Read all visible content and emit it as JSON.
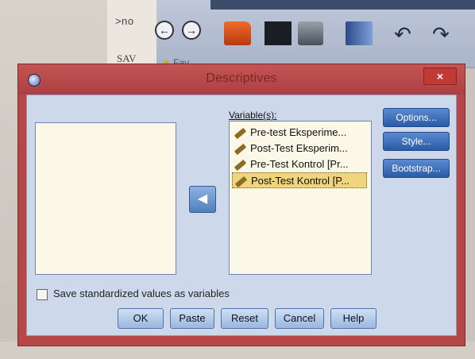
{
  "background": {
    "code_line_1": ">no",
    "code_line_2": "SAV",
    "fav_label": "Fav"
  },
  "dialog": {
    "title": "Descriptives",
    "close_label": "×",
    "variables_label": "Variable(s):",
    "variables": [
      {
        "label": "Pre-test Eksperime...",
        "selected": false
      },
      {
        "label": "Post-Test Eksperim...",
        "selected": false
      },
      {
        "label": "Pre-Test Kontrol [Pr...",
        "selected": false
      },
      {
        "label": "Post-Test Kontrol [P...",
        "selected": true
      }
    ],
    "side_buttons": {
      "options": "Options...",
      "style": "Style...",
      "bootstrap": "Bootstrap..."
    },
    "save_checkbox_label": "Save standardized values as variables",
    "save_checked": false,
    "buttons": {
      "ok": "OK",
      "paste": "Paste",
      "reset": "Reset",
      "cancel": "Cancel",
      "help": "Help"
    }
  },
  "colors": {
    "dialog_frame": "#b54748",
    "client": "#cdd9ea",
    "list_bg": "#fbf8e8",
    "selection": "#f1d47e",
    "button_blue": "#2a5ba6"
  }
}
